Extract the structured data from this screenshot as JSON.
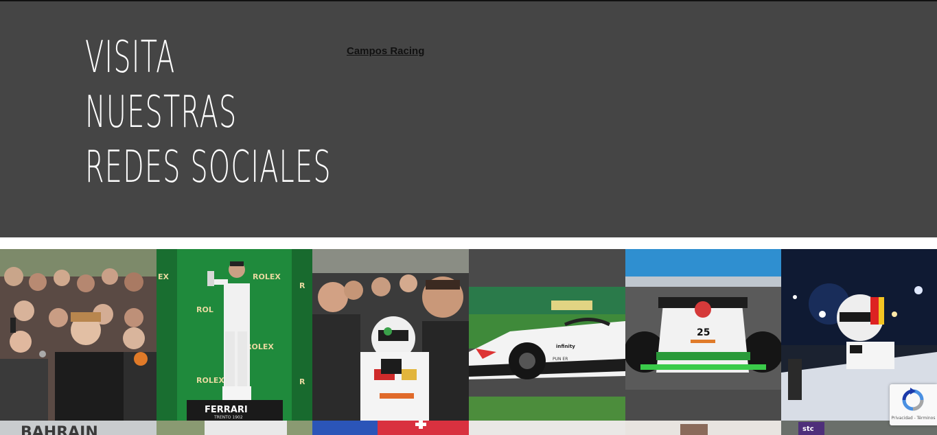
{
  "hero": {
    "title_lines": [
      "VISITA",
      "NUESTRAS",
      "REDES SOCIALES"
    ],
    "link_label": "Campos Racing"
  },
  "gallery": {
    "tiles": [
      {
        "subject": "fans-selfie-photo"
      },
      {
        "subject": "podium-trophy-photo",
        "visible_text": [
          "ROLEX",
          "FERRARI",
          "TRENTO 1902"
        ]
      },
      {
        "subject": "team-celebration-photo"
      },
      {
        "subject": "race-car-track-photo"
      },
      {
        "subject": "race-car-front-photo",
        "car_number": "25"
      },
      {
        "subject": "driver-in-cockpit-photo"
      }
    ],
    "second_row_partial_text": [
      "BAHRAIN",
      "stc"
    ]
  },
  "recaptcha": {
    "label": "Privacidad - Términos"
  },
  "colors": {
    "hero_background": "#454545",
    "title_text": "#ffffff",
    "link_text": "#111111"
  }
}
